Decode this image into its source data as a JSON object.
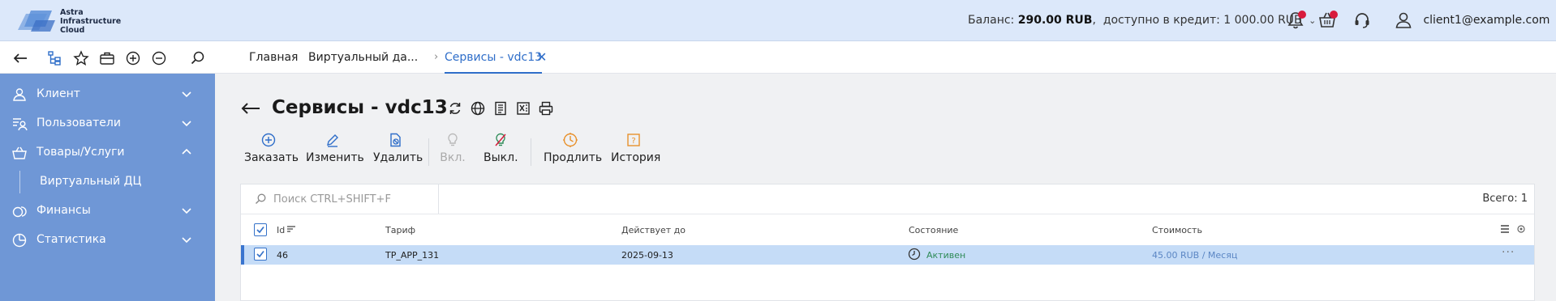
{
  "header": {
    "logo_lines": [
      "Astra",
      "Infrastructure",
      "Cloud"
    ],
    "balance_label": "Баланс:",
    "balance_value": "290.00 RUB",
    "credit_label": "доступно в кредит:",
    "credit_value": "1 000.00 RUB",
    "user_email": "client1@example.com",
    "badge_color": "#d81b3c"
  },
  "toolbar": {
    "icons": [
      "back-arrow-icon",
      "tree-icon",
      "star-icon",
      "briefcase-icon",
      "add-circle-icon",
      "remove-circle-icon",
      "search-icon"
    ]
  },
  "tabs": [
    {
      "label": "Главная",
      "active": false
    },
    {
      "label": "Виртуальный да...",
      "active": false
    },
    {
      "label": "Сервисы - vdc13",
      "active": true
    }
  ],
  "sidebar": {
    "items": [
      {
        "label": "Клиент",
        "icon": "user-icon",
        "expanded": false
      },
      {
        "label": "Пользователи",
        "icon": "users-icon",
        "expanded": false
      },
      {
        "label": "Товары/Услуги",
        "icon": "basket-icon",
        "expanded": true
      },
      {
        "label": "Финансы",
        "icon": "coins-icon",
        "expanded": false
      },
      {
        "label": "Статистика",
        "icon": "pie-chart-icon",
        "expanded": false
      }
    ],
    "subitem": "Виртуальный ДЦ",
    "bg_color": "#6f97d6"
  },
  "page": {
    "title": "Сервисы - vdc13"
  },
  "actions": [
    {
      "label": "Заказать",
      "icon": "add-circle-icon",
      "enabled": true
    },
    {
      "label": "Изменить",
      "icon": "edit-icon",
      "enabled": true
    },
    {
      "label": "Удалить",
      "icon": "delete-icon",
      "enabled": true
    },
    {
      "label": "Вкл.",
      "icon": "bulb-on-icon",
      "enabled": false
    },
    {
      "label": "Выкл.",
      "icon": "bulb-off-icon",
      "enabled": true
    },
    {
      "label": "Продлить",
      "icon": "renew-icon",
      "enabled": true
    },
    {
      "label": "История",
      "icon": "history-icon",
      "enabled": true
    }
  ],
  "table": {
    "search_placeholder": "Поиск CTRL+SHIFT+F",
    "total": "Всего: 1",
    "columns": [
      "Id",
      "Тариф",
      "Действует до",
      "Состояние",
      "Стоимость"
    ],
    "rows": [
      {
        "id": "46",
        "tariff": "TP_APP_131",
        "valid_until": "2025-09-13",
        "status": "Активен",
        "cost": "45.00 RUB / Месяц",
        "checked": true
      }
    ],
    "accent_color": "#2f6ec9",
    "selected_row_color": "#c5dcf7"
  }
}
